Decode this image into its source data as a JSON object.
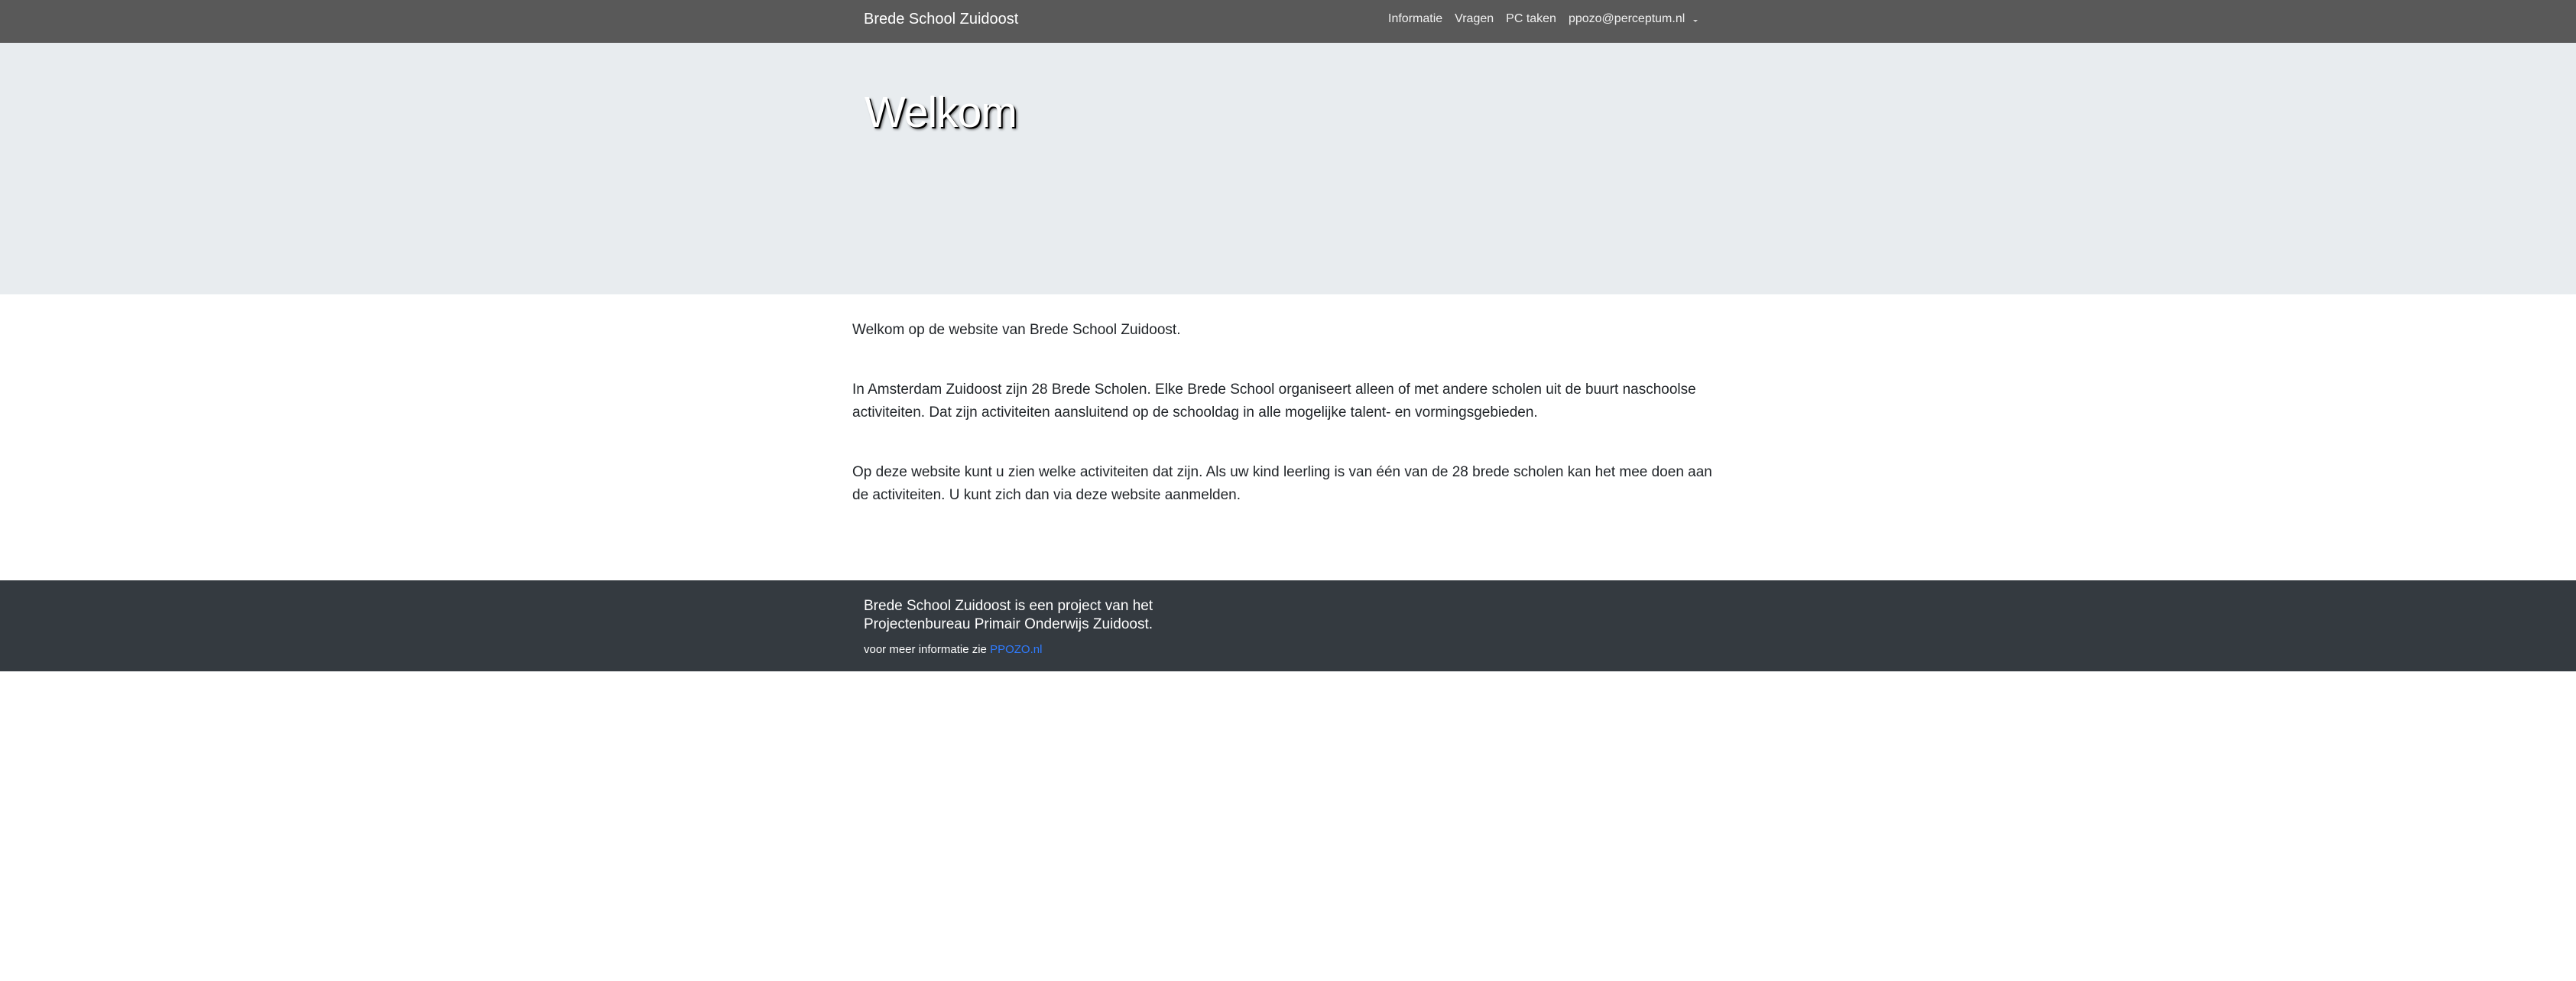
{
  "navbar": {
    "brand": "Brede School Zuidoost",
    "items": [
      {
        "label": "Informatie"
      },
      {
        "label": "Vragen"
      },
      {
        "label": "PC taken"
      }
    ],
    "account": "ppozo@perceptum.nl"
  },
  "hero": {
    "title": "Welkom"
  },
  "content": {
    "p1": "Welkom op de website van Brede School Zuidoost.",
    "p2": "In Amsterdam Zuidoost zijn 28 Brede Scholen. Elke Brede School organiseert alleen of met andere scholen uit de buurt naschoolse activiteiten. Dat zijn activiteiten aansluitend op de schooldag in alle mogelijke talent- en vormingsgebieden.",
    "p3": "Op deze website kunt u zien welke activiteiten dat zijn. Als uw kind leerling is van één van de 28 brede scholen kan het mee doen aan de activiteiten. U kunt zich dan via deze website aanmelden."
  },
  "footer": {
    "tagline": "Brede School Zuidoost is een project van het Projectenbureau Primair Onderwijs Zuidoost.",
    "more_prefix": "voor meer informatie zie",
    "link_label": "PPOZO.nl"
  },
  "colors": {
    "navbar": "#595959",
    "hero": "#e8ecef",
    "footer": "#343a40",
    "link": "#2f7bff"
  }
}
